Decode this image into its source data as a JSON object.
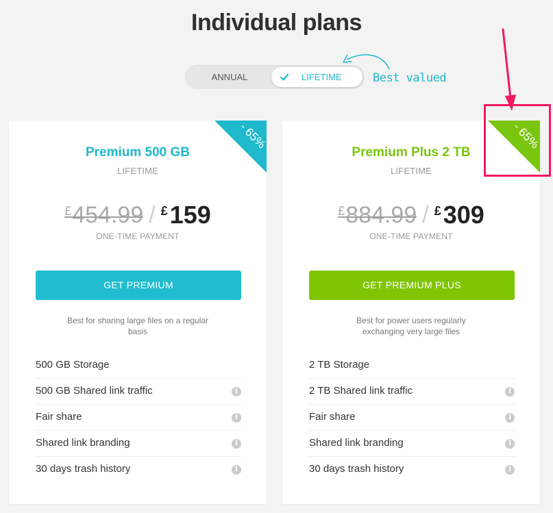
{
  "page": {
    "title": "Individual plans"
  },
  "toggle": {
    "annual": "ANNUAL",
    "lifetime": "LIFETIME",
    "selected": "LIFETIME"
  },
  "annotation": {
    "best_valued": "Best valued"
  },
  "plans": [
    {
      "name": "Premium 500 GB",
      "subtitle": "LIFETIME",
      "discount": "- 65%",
      "currency": "£",
      "old_price": "454.99",
      "separator": "/",
      "new_price": "159",
      "payment_label": "ONE-TIME PAYMENT",
      "cta": "GET PREMIUM",
      "description": "Best for sharing large files on a regular basis",
      "features": [
        {
          "label": "500 GB Storage",
          "info": false
        },
        {
          "label": "500 GB Shared link traffic",
          "info": true
        },
        {
          "label": "Fair share",
          "info": true
        },
        {
          "label": "Shared link branding",
          "info": true
        },
        {
          "label": "30 days trash history",
          "info": true
        }
      ]
    },
    {
      "name": "Premium Plus 2 TB",
      "subtitle": "LIFETIME",
      "discount": "- 65%",
      "currency": "£",
      "old_price": "884.99",
      "separator": "/",
      "new_price": "309",
      "payment_label": "ONE-TIME PAYMENT",
      "cta": "GET PREMIUM PLUS",
      "description": "Best for power users regularly exchanging very large files",
      "features": [
        {
          "label": "2 TB Storage",
          "info": false
        },
        {
          "label": "2 TB Shared link traffic",
          "info": true
        },
        {
          "label": "Fair share",
          "info": true
        },
        {
          "label": "Shared link branding",
          "info": true
        },
        {
          "label": "30 days trash history",
          "info": true
        }
      ]
    }
  ],
  "info_glyph": "i",
  "colors": {
    "accent_teal": "#1fb8cc",
    "accent_green": "#7ac50e",
    "highlight_pink": "#f0195f",
    "background": "#f3f3f3"
  },
  "icons": {
    "check": "check-icon",
    "info": "info-icon",
    "annotation_arrow": "curved-arrow-icon",
    "highlight_arrow": "arrow-down-icon"
  }
}
